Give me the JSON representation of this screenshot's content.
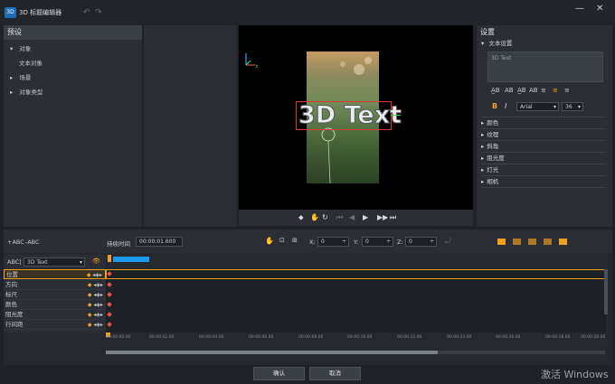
{
  "window": {
    "app_icon_text": "3D",
    "title": "3D 标题编辑器",
    "undo_icon": "undo-arrow-icon",
    "redo_icon": "redo-arrow-icon",
    "min_icon": "minimize-icon",
    "close_icon": "close-icon",
    "min_glyph": "—",
    "close_glyph": "✕"
  },
  "left_panel": {
    "header": "预设",
    "tree": [
      {
        "label": "对象",
        "expanded": true,
        "level": 0
      },
      {
        "label": "文本对象",
        "level": 1
      },
      {
        "label": "场景",
        "expanded": false,
        "level": 0
      },
      {
        "label": "对象类型",
        "expanded": false,
        "level": 0
      }
    ],
    "arrow_down": "▾",
    "arrow_right": "▸"
  },
  "preview": {
    "title_text": "3D Text",
    "axis_x": "x",
    "controls": [
      "⬥",
      "✋",
      "↻",
      "⏮",
      "◀",
      "▶",
      "▶▶",
      "⏭"
    ]
  },
  "settings": {
    "header": "设置",
    "text_settings": "文本设置",
    "text_value": "3D Text",
    "format_icons": [
      "A̲B",
      "AB",
      "A̲B",
      "AB",
      "≡",
      "≡",
      "≡"
    ],
    "bold": "B",
    "italic": "I",
    "font": "Arial",
    "font_size": "36",
    "sections": [
      "颜色",
      "纹理",
      "斜角",
      "阻光度",
      "灯光",
      "相机"
    ],
    "accent": "#f0a020"
  },
  "timeline": {
    "add_text_btn": "+ABC",
    "remove_text_btn": "-ABC",
    "duration_label": "持续时间",
    "duration_value": "00:00:01.600",
    "x_label": "X:",
    "x_value": "0",
    "y_label": "Y:",
    "y_value": "0",
    "z_label": "Z:",
    "z_value": "0",
    "object_label": "ABC|",
    "object_select": "3D Text",
    "tracks": [
      "位置",
      "方向",
      "标尺",
      "颜色",
      "阻光度",
      "行间距"
    ],
    "ruler": [
      "00:00:00.00",
      "00:00:02.00",
      "00:00:04.00",
      "00:00:06.00",
      "00:00:08.00",
      "00:00:10.00",
      "00:00:12.00",
      "00:00:14.00",
      "00:00:16.00",
      "00:00:18.00",
      "00:00:20.00"
    ]
  },
  "footer": {
    "ok": "确认",
    "cancel": "取消",
    "watermark": "激活 Windows"
  }
}
